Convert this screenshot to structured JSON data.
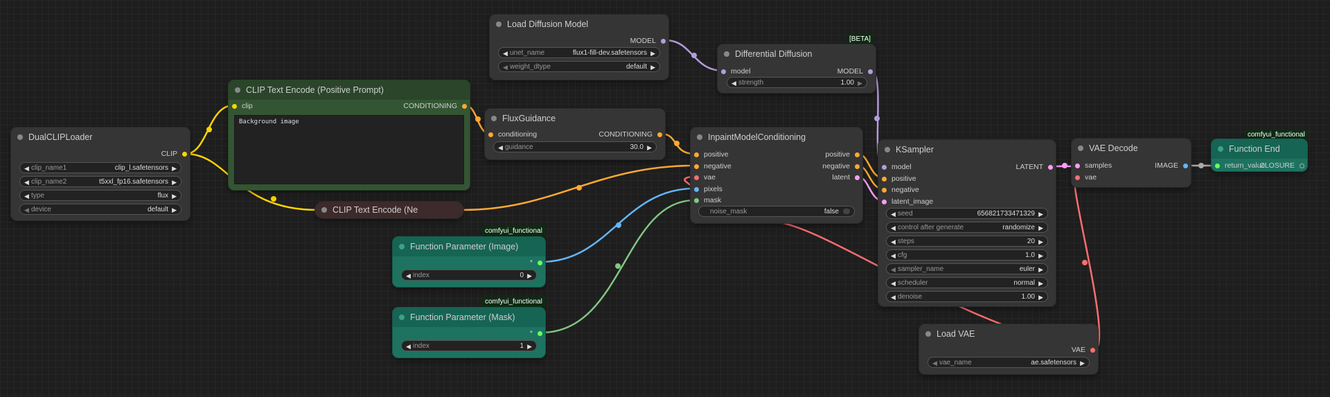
{
  "colors": {
    "clip": "#ffd500",
    "conditioning": "#ffa931",
    "model": "#b39ddb",
    "vae": "#ff6e6e",
    "image": "#64b5f6",
    "mask": "#81c784",
    "latent": "#ff9cf9",
    "closure": "#aaaaaa",
    "any": "#66ff66"
  },
  "nodes": {
    "dualclip": {
      "title": "DualCLIPLoader",
      "out_clip": "CLIP",
      "clip_name1_label": "clip_name1",
      "clip_name1_value": "clip_l.safetensors",
      "clip_name2_label": "clip_name2",
      "clip_name2_value": "t5xxl_fp16.safetensors",
      "type_label": "type",
      "type_value": "flux",
      "device_label": "device",
      "device_value": "default"
    },
    "clip_pos": {
      "title": "CLIP Text Encode (Positive Prompt)",
      "in_clip": "clip",
      "out_conditioning": "CONDITIONING",
      "text": "Background image"
    },
    "clip_neg": {
      "title": "CLIP Text Encode (Ne"
    },
    "load_diffusion": {
      "title": "Load Diffusion Model",
      "out_model": "MODEL",
      "unet_name_label": "unet_name",
      "unet_name_value": "flux1-fill-dev.safetensors",
      "weight_dtype_label": "weight_dtype",
      "weight_dtype_value": "default"
    },
    "flux_guidance": {
      "title": "FluxGuidance",
      "in_conditioning": "conditioning",
      "out_conditioning": "CONDITIONING",
      "guidance_label": "guidance",
      "guidance_value": "30.0"
    },
    "diff_diffusion": {
      "badge": "[BETA]",
      "title": "Differential Diffusion",
      "in_model": "model",
      "out_model": "MODEL",
      "strength_label": "strength",
      "strength_value": "1.00"
    },
    "inpaint": {
      "title": "InpaintModelConditioning",
      "in_positive": "positive",
      "in_negative": "negative",
      "in_vae": "vae",
      "in_pixels": "pixels",
      "in_mask": "mask",
      "out_positive": "positive",
      "out_negative": "negative",
      "out_latent": "latent",
      "noise_mask_label": "noise_mask",
      "noise_mask_value": "false"
    },
    "ksampler": {
      "title": "KSampler",
      "in_model": "model",
      "in_positive": "positive",
      "in_negative": "negative",
      "in_latent": "latent_image",
      "out_latent": "LATENT",
      "seed_label": "seed",
      "seed_value": "656821733471329",
      "control_label": "control after generate",
      "control_value": "randomize",
      "steps_label": "steps",
      "steps_value": "20",
      "cfg_label": "cfg",
      "cfg_value": "1.0",
      "sampler_label": "sampler_name",
      "sampler_value": "euler",
      "scheduler_label": "scheduler",
      "scheduler_value": "normal",
      "denoise_label": "denoise",
      "denoise_value": "1.00"
    },
    "vae_decode": {
      "title": "VAE Decode",
      "in_samples": "samples",
      "in_vae": "vae",
      "out_image": "IMAGE"
    },
    "function_end": {
      "badge": "comfyui_functional",
      "title": "Function End",
      "in_return": "return_value",
      "out_closure": "CLOSURE"
    },
    "param_image": {
      "badge": "comfyui_functional",
      "title": "Function Parameter (Image)",
      "out_any": "*",
      "index_label": "index",
      "index_value": "0"
    },
    "param_mask": {
      "badge": "comfyui_functional",
      "title": "Function Parameter (Mask)",
      "out_any": "*",
      "index_label": "index",
      "index_value": "1"
    },
    "load_vae": {
      "title": "Load VAE",
      "out_vae": "VAE",
      "vae_name_label": "vae_name",
      "vae_name_value": "ae.safetensors"
    }
  }
}
